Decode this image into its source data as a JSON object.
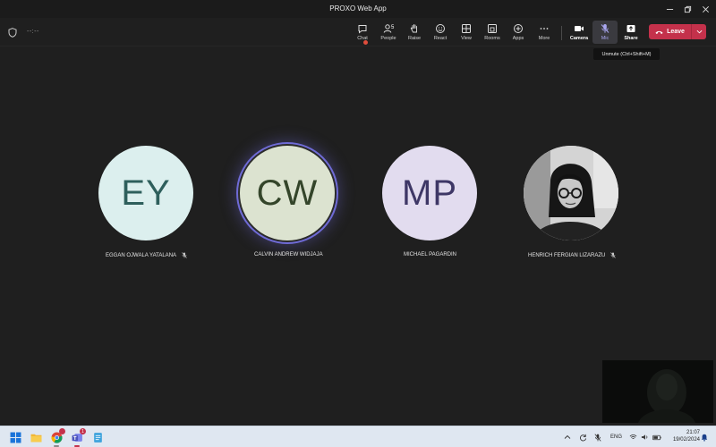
{
  "window": {
    "title": "PROXO Web App"
  },
  "meeting": {
    "timer": "--:--",
    "people_count": "5"
  },
  "toolbar": {
    "chat": "Chat",
    "people": "People",
    "raise": "Raise",
    "react": "React",
    "view": "View",
    "rooms": "Rooms",
    "apps": "Apps",
    "more": "More",
    "camera": "Camera",
    "mic": "Mic",
    "share": "Share",
    "leave": "Leave",
    "mic_tooltip": "Unmute (Ctrl+Shift+M)"
  },
  "participants": [
    {
      "initials": "EY",
      "name": "EGGAN OJWALA YATALANA",
      "muted": true,
      "bg": "#dcefee",
      "fg": "#2e5f5c"
    },
    {
      "initials": "CW",
      "name": "CALVIN ANDREW WIDJAJA",
      "muted": false,
      "speaking": true,
      "bg": "#dce3d0",
      "fg": "#34452a"
    },
    {
      "initials": "MP",
      "name": "MICHAEL PAGARDIN",
      "muted": false,
      "bg": "#e2dcef",
      "fg": "#3e3766"
    },
    {
      "initials": "",
      "name": "HENRICH FERGIAN LIZARAZU",
      "muted": true,
      "has_photo": true
    }
  ],
  "taskbar": {
    "chrome_badge": "",
    "teams_badge": "1",
    "language": "ENG",
    "time": "21:07",
    "date": "19/02/2024"
  },
  "colors": {
    "accent": "#6f6bd6",
    "leave": "#c4314b",
    "background": "#1f1f1f"
  },
  "icons": [
    "shield-icon",
    "chat-icon",
    "people-icon",
    "raise-hand-icon",
    "react-icon",
    "view-icon",
    "rooms-icon",
    "apps-icon",
    "more-icon",
    "camera-icon",
    "mic-off-icon",
    "share-icon",
    "phone-hangup-icon",
    "chevron-down-icon"
  ]
}
